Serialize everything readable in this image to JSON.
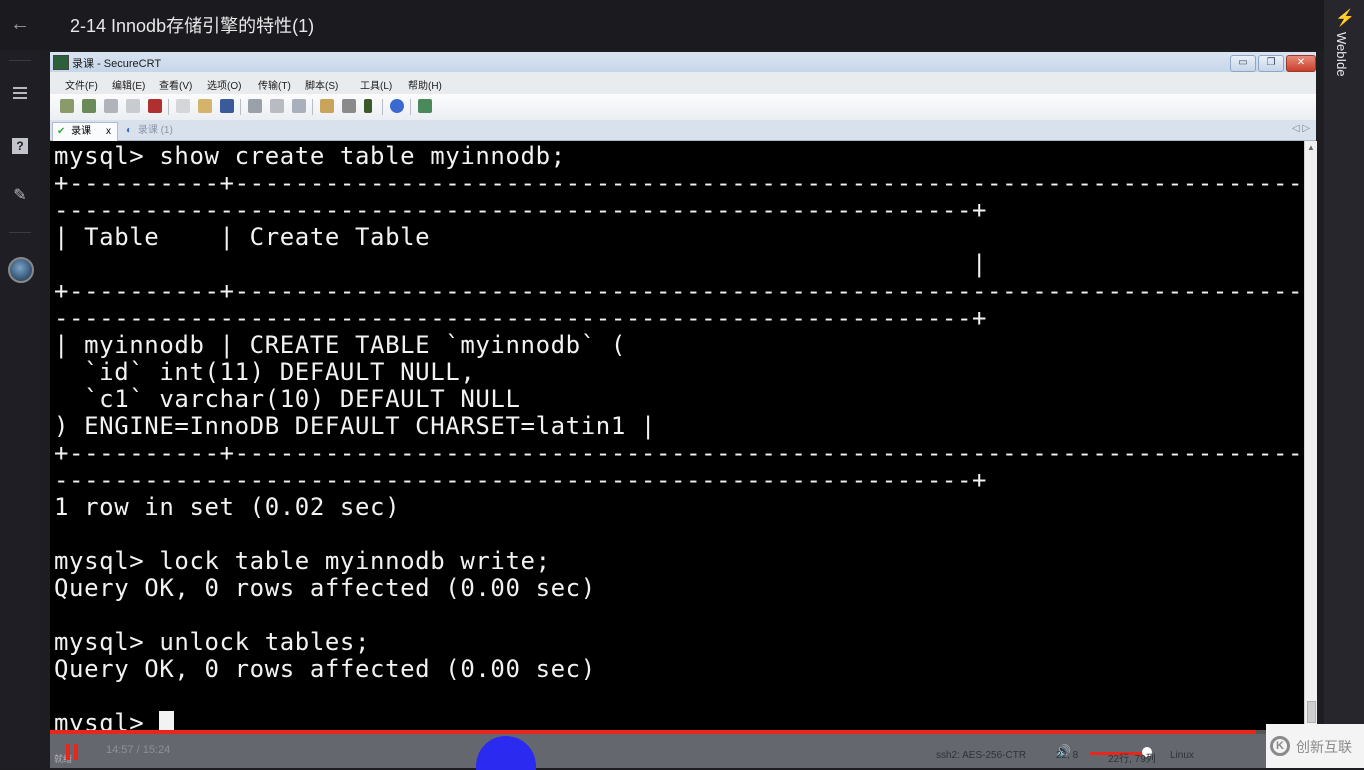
{
  "header": {
    "back_icon": "←",
    "title": "2-14 Innodb存储引擎的特性(1)"
  },
  "left_rail": {
    "items": [
      {
        "name": "menu-icon"
      },
      {
        "name": "question-icon",
        "glyph": "?"
      },
      {
        "name": "pencil-icon",
        "glyph": "✎"
      },
      {
        "name": "avatar"
      }
    ]
  },
  "right_rail": {
    "icon": "⚡",
    "label": "WebIde"
  },
  "securecrt": {
    "window_title": "录课 - SecureCRT",
    "window_buttons": {
      "minimize": "▭",
      "restore": "❐",
      "close": "✕"
    },
    "menu": [
      "文件(F)",
      "编辑(E)",
      "查看(V)",
      "选项(O)",
      "传输(T)",
      "脚本(S)",
      "工具(L)",
      "帮助(H)"
    ],
    "tabs": [
      {
        "label": "录课",
        "active": true,
        "icon": "✔",
        "close": "x"
      },
      {
        "label": "录课 (1)",
        "active": false,
        "icon": "◐"
      }
    ],
    "tab_nav": "◁ ▷",
    "terminal_lines": [
      "mysql> show create table myinnodb;",
      "+----------+-----------------------------------------------------------------------------",
      "-------------------------------------------------------------+",
      "| Table    | Create Table",
      "                                                             |",
      "+----------+-----------------------------------------------------------------------------",
      "-------------------------------------------------------------+",
      "| myinnodb | CREATE TABLE `myinnodb` (",
      "  `id` int(11) DEFAULT NULL,",
      "  `c1` varchar(10) DEFAULT NULL",
      ") ENGINE=InnoDB DEFAULT CHARSET=latin1 |",
      "+----------+-----------------------------------------------------------------------------",
      "-------------------------------------------------------------+",
      "1 row in set (0.02 sec)",
      "",
      "mysql> lock table myinnodb write;",
      "Query OK, 0 rows affected (0.00 sec)",
      "",
      "mysql> unlock tables;",
      "Query OK, 0 rows affected (0.00 sec)",
      "",
      "mysql> "
    ],
    "status_bar": {
      "protocol": "ssh2: AES-256-CTR",
      "cursor_pos": "22,  8",
      "size": "22行, 79列",
      "os": "Linux"
    }
  },
  "player": {
    "progress_percent": 95.3,
    "time": "14:57 / 15:24",
    "live_label": "就绪",
    "volume_percent": 90
  },
  "brand": {
    "logo": "K",
    "name": "创新互联"
  },
  "colors": {
    "accent_red": "#e8261c",
    "terminal_bg": "#000000",
    "terminal_fg": "#f2f2f2",
    "webide_blue": "#3a9cf0"
  }
}
